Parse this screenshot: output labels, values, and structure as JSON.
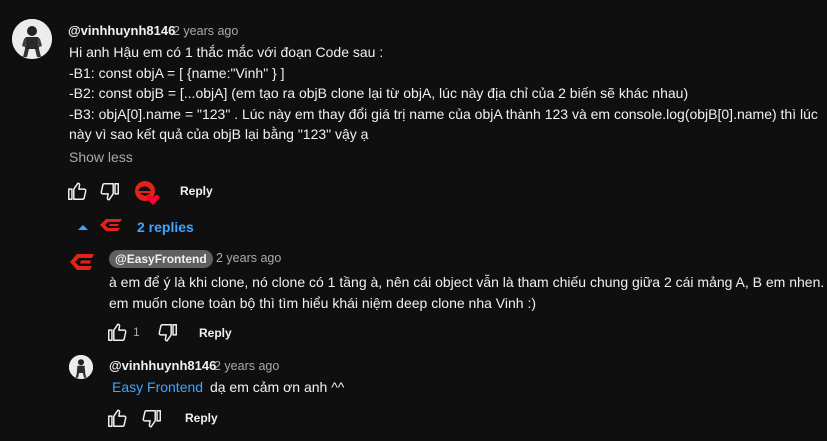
{
  "comment": {
    "author": "@vinhhuynh8146",
    "time": "2 years ago",
    "lines": [
      "Hi anh Hậu em có 1 thắc mắc với đoạn Code sau :",
      "-B1:  const objA = [ {name:\"Vinh\" } ]",
      "-B2: const objB = [...objA]   (em tạo ra objB clone lại từ objA, lúc này địa chỉ của 2 biến sẽ khác nhau)",
      "-B3: objA[0].name = \"123\" . Lúc này em thay đổi giá trị name của objA thành 123 và em console.log(objB[0].name) thì lúc",
      "này vì sao kết quả của objB lại bằng \"123\" vậy ạ"
    ],
    "show_less": "Show less",
    "reply_label": "Reply"
  },
  "replies_toggle": {
    "label": "2 replies"
  },
  "replies": [
    {
      "author": "@EasyFrontend",
      "time": "2 years ago",
      "lines": [
        "à em để ý là khi clone, nó clone có 1 tầng à, nên cái object vẫn là tham chiếu chung giữa 2 cái mảng A, B em nhen.",
        "em muốn clone toàn bộ thì tìm hiểu khái niệm deep clone nha Vinh :)"
      ],
      "like_count": "1",
      "reply_label": "Reply"
    },
    {
      "author": "@vinhhuynh8146",
      "time": "2 years ago",
      "mention": "Easy Frontend",
      "text": "dạ em cảm ơn anh ^^",
      "reply_label": "Reply"
    }
  ],
  "colors": {
    "background": "#0f0f0f",
    "text": "#f1f1f1",
    "secondary": "#aaaaaa",
    "link": "#3ea6ff",
    "brand_red": "#e62117",
    "chip": "#606060"
  },
  "icons": {
    "like": "thumbs-up-icon",
    "dislike": "thumbs-down-icon",
    "creator_heart": "creator-heart-icon",
    "chevron": "chevron-up-icon",
    "brand": "easy-frontend-logo-icon"
  }
}
